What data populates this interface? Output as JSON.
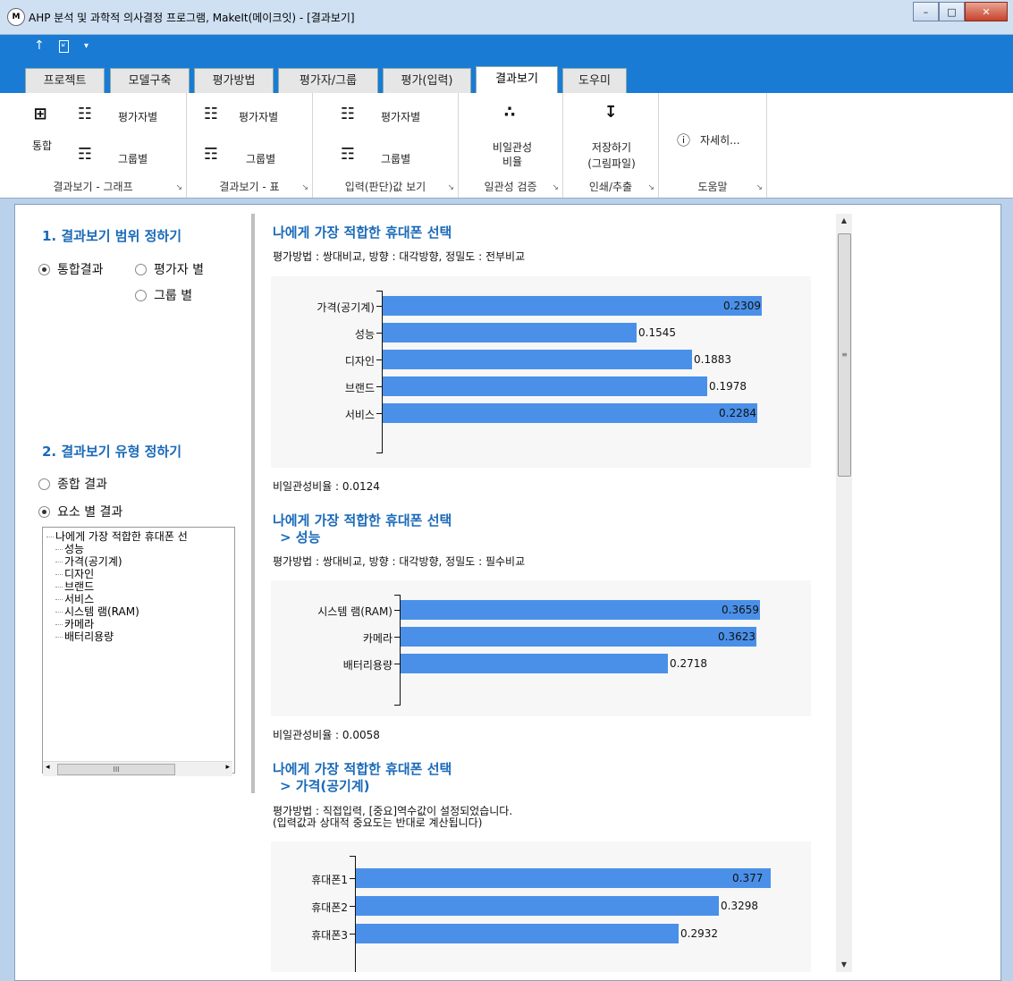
{
  "window": {
    "title": "AHP 분석 및 과학적 의사결정 프로그램, MakeIt(메이크잇) - [결과보기]",
    "app_icon": "M"
  },
  "tabs": [
    "프로젝트",
    "모델구축",
    "평가방법",
    "평가자/그룹",
    "평가(입력)",
    "결과보기",
    "도우미"
  ],
  "active_tab": "결과보기",
  "ribbon": {
    "graph_group": {
      "label": "결과보기 - 그래프",
      "integrated": "통합",
      "by_evaluator": "평가자별",
      "by_group": "그룹별"
    },
    "table_group": {
      "label": "결과보기 - 표",
      "by_evaluator": "평가자별",
      "by_group": "그룹별"
    },
    "input_group": {
      "label": "입력(판단)값 보기",
      "by_evaluator": "평가자별",
      "by_group": "그룹별"
    },
    "consistency_group": {
      "label": "일관성 검증",
      "ratio_line1": "비일관성",
      "ratio_line2": "비율"
    },
    "export_group": {
      "label": "인쇄/추출",
      "save_line1": "저장하기",
      "save_line2": "(그림파일)"
    },
    "help_group": {
      "label": "도움말",
      "detail": "자세히..."
    }
  },
  "left": {
    "section1": "1. 결과보기 범위 정하기",
    "scope_integrated": "통합결과",
    "scope_evaluator": "평가자 별",
    "scope_group": "그룹 별",
    "section2": "2. 결과보기 유형 정하기",
    "type_total": "종합 결과",
    "type_element": "요소 별 결과",
    "tree": [
      "나에게 가장 적합한 휴대폰 선",
      "성능",
      "가격(공기계)",
      "디자인",
      "브랜드",
      "서비스",
      "시스템 램(RAM)",
      "카메라",
      "배터리용량"
    ],
    "hscroll_grip": "III"
  },
  "sections": [
    {
      "title1": "나에게 가장 적합한 휴대폰 선택",
      "title2": "",
      "meta1": "평가방법 : 쌍대비교, 방향 : 대각방향, 정밀도 : 전부비교",
      "meta2": "",
      "ratio": "비일관성비율 : 0.0124",
      "chart_data": {
        "type": "bar",
        "orientation": "horizontal",
        "categories": [
          "가격(공기계)",
          "성능",
          "디자인",
          "브랜드",
          "서비스"
        ],
        "values": [
          0.2309,
          0.1545,
          0.1883,
          0.1978,
          0.2284
        ],
        "labels": [
          "0.2309",
          "0.1545",
          "0.1883",
          "0.1978",
          "0.2284"
        ],
        "xlim": [
          0,
          0.2309
        ]
      }
    },
    {
      "title1": "나에게 가장 적합한 휴대폰 선택",
      "title2": "> 성능",
      "meta1": "평가방법 : 쌍대비교, 방향 : 대각방향, 정밀도 : 필수비교",
      "meta2": "",
      "ratio": "비일관성비율 : 0.0058",
      "chart_data": {
        "type": "bar",
        "orientation": "horizontal",
        "categories": [
          "시스템 램(RAM)",
          "카메라",
          "배터리용량"
        ],
        "values": [
          0.3659,
          0.3623,
          0.2718
        ],
        "labels": [
          "0.3659",
          "0.3623",
          "0.2718"
        ],
        "xlim": [
          0,
          0.3659
        ]
      }
    },
    {
      "title1": "나에게 가장 적합한 휴대폰 선택",
      "title2": "> 가격(공기계)",
      "meta1": "평가방법 : 직접입력, [중요]역수값이 설정되었습니다.",
      "meta2": "(입력값과 상대적 중요도는 반대로 계산됩니다)",
      "ratio": "",
      "chart_data": {
        "type": "bar",
        "orientation": "horizontal",
        "categories": [
          "휴대폰1",
          "휴대폰2",
          "휴대폰3"
        ],
        "values": [
          0.377,
          0.3298,
          0.2932
        ],
        "labels": [
          "0.377",
          "0.3298",
          "0.2932"
        ],
        "xlim": [
          0,
          0.377
        ]
      }
    }
  ],
  "colors": {
    "bar": "#4a90e8",
    "title_blue": "#1a6ab8",
    "ribbon_blue": "#1a7bd4"
  }
}
